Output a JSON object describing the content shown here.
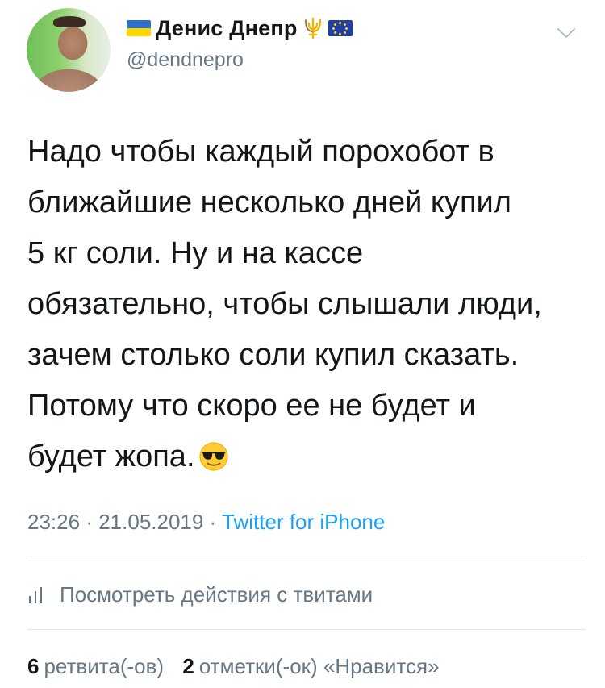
{
  "user": {
    "name": "Денис Днепр",
    "handle": "@dendnepro"
  },
  "tweet": {
    "text": "Надо чтобы каждый порохобот в\nближайшие несколько дней купил\n5 кг соли. Ну и на кассе\nобязательно, чтобы слышали люди,\nзачем столько соли купил сказать.\nПотому что скоро ее не будет и\nбудет жопа.",
    "time": "23:26",
    "separator": "·",
    "date": "21.05.2019",
    "source": "Twitter for iPhone"
  },
  "actions": {
    "view_activity": "Посмотреть действия с твитами"
  },
  "stats": {
    "retweets_count": "6",
    "retweets_label": "ретвита(-ов)",
    "likes_count": "2",
    "likes_label": "отметки(-ок) «Нравится»"
  },
  "icons": {
    "flag_left": "ukraine-flag-icon",
    "trident": "trident-icon",
    "flag_right": "eu-flag-icon",
    "menu": "chevron-down-icon",
    "emoji": "sunglasses-emoji-icon",
    "activity": "bar-chart-icon"
  },
  "colors": {
    "link": "#1da1f2",
    "muted": "#657786",
    "text": "#14171a"
  }
}
